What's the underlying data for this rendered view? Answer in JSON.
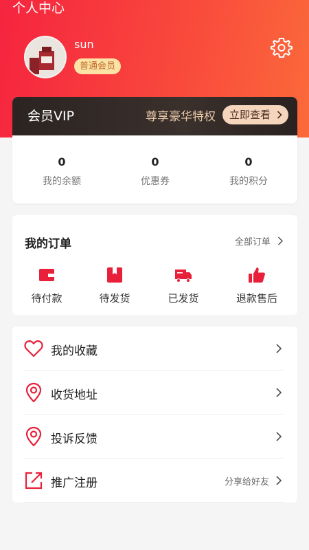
{
  "header": {
    "title": "个人中心",
    "username": "sun",
    "member_level": "普通会员"
  },
  "vip": {
    "title": "会员VIP",
    "slogan": "尊享豪华特权",
    "button_label": "立即查看"
  },
  "stats": [
    {
      "value": "0",
      "label": "我的余额"
    },
    {
      "value": "0",
      "label": "优惠券"
    },
    {
      "value": "0",
      "label": "我的积分"
    }
  ],
  "orders": {
    "title": "我的订单",
    "all_label": "全部订单",
    "items": [
      {
        "label": "待付款",
        "icon": "wallet-icon"
      },
      {
        "label": "待发货",
        "icon": "package-icon"
      },
      {
        "label": "已发货",
        "icon": "truck-icon"
      },
      {
        "label": "退款售后",
        "icon": "thumbs-up-icon"
      }
    ]
  },
  "menu": [
    {
      "label": "我的收藏",
      "icon": "heart-icon",
      "extra": ""
    },
    {
      "label": "收货地址",
      "icon": "location-pin-icon",
      "extra": ""
    },
    {
      "label": "投诉反馈",
      "icon": "location-pin-icon",
      "extra": ""
    },
    {
      "label": "推广注册",
      "icon": "share-out-icon",
      "extra": "分享给好友"
    }
  ],
  "colors": {
    "primary_red": "#e8203a",
    "header_gradient_start": "#f5243f",
    "header_gradient_end": "#fb6a3a",
    "badge_bg": "#fbe3a6",
    "vip_bg": "#2c2422",
    "vip_gold": "#e8c9a8"
  }
}
